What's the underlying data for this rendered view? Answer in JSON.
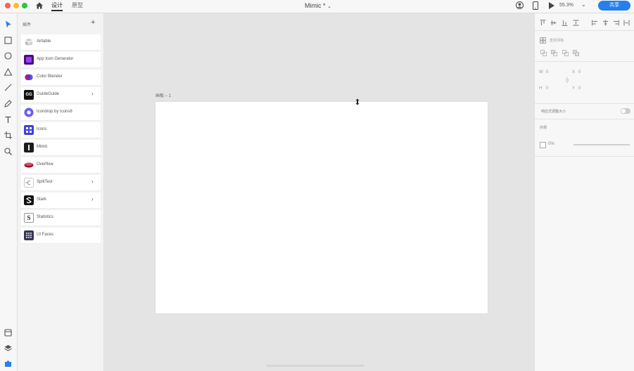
{
  "window": {
    "title": "Mimic *",
    "tabs": [
      {
        "label": "设计",
        "active": true
      },
      {
        "label": "原型",
        "active": false
      }
    ],
    "zoom": "55.3%",
    "share_label": "共享"
  },
  "plugins_panel": {
    "title": "插件",
    "items": [
      {
        "label": "Airtable",
        "icon": "airtable-icon",
        "has_chevron": false
      },
      {
        "label": "App Icon Generator",
        "icon": "app-icon-generator-icon",
        "has_chevron": false
      },
      {
        "label": "Color Blender",
        "icon": "color-blender-icon",
        "has_chevron": false
      },
      {
        "label": "GuideGuide",
        "icon_text": "GG",
        "has_chevron": true
      },
      {
        "label": "Icondrop by Icons8",
        "icon": "iconsoout-icon",
        "has_chevron": false
      },
      {
        "label": "Icons",
        "icon": "icons-plugin-icon",
        "has_chevron": false
      },
      {
        "label": "Mimic",
        "icon": "mimic-icon",
        "has_chevron": false
      },
      {
        "label": "Overflow",
        "icon": "overflow-icon",
        "has_chevron": false
      },
      {
        "label": "SplitTest",
        "icon": "splittest-icon",
        "has_chevron": true
      },
      {
        "label": "Stark",
        "icon": "stark-icon",
        "has_chevron": true
      },
      {
        "label": "Statistics",
        "icon_text": "S",
        "has_chevron": false
      },
      {
        "label": "UI Faces",
        "icon": "ui-faces-icon",
        "has_chevron": false
      }
    ]
  },
  "canvas": {
    "artboard_label": "画板 – 1"
  },
  "inspector": {
    "repeat_grid_label": "重复网格",
    "width_label": "W",
    "width_value": "0",
    "height_label": "H",
    "height_value": "0",
    "x_label": "X",
    "x_value": "0",
    "y_label": "Y",
    "y_value": "0",
    "responsive_resize_label": "响应式调整大小",
    "appearance_label": "外观",
    "opacity_value": "0%"
  },
  "colors": {
    "accent": "#2680eb",
    "canvas_bg": "#e4e4e4",
    "panel_bg": "#f3f3f3"
  }
}
